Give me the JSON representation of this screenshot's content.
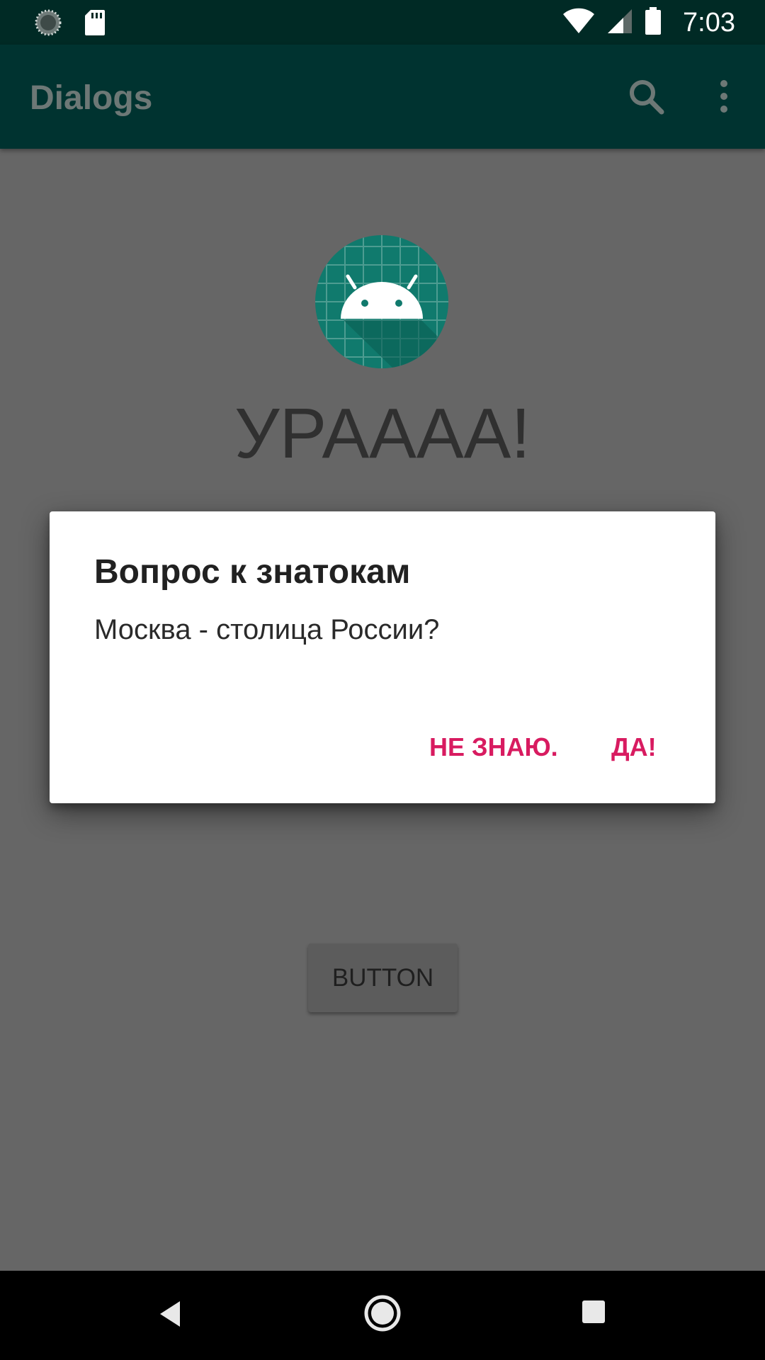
{
  "status_bar": {
    "time": "7:03",
    "left_icons": [
      "sync-icon",
      "sd-card-icon"
    ],
    "right_icons": [
      "wifi-icon",
      "cell-signal-icon",
      "battery-icon"
    ]
  },
  "app_bar": {
    "title": "Dialogs",
    "actions": [
      "search-icon",
      "more-vert-icon"
    ]
  },
  "main": {
    "heading": "УРАААА!",
    "button_label": "BUTTON"
  },
  "dialog": {
    "title": "Вопрос к знатокам",
    "message": "Москва - столица России?",
    "negative_button": "НЕ ЗНАЮ.",
    "positive_button": "ДА!"
  },
  "nav_bar": {
    "buttons": [
      "back-icon",
      "home-icon",
      "recents-icon"
    ]
  },
  "colors": {
    "status_bar": "#002a25",
    "app_bar": "#003330",
    "scrim_background": "#666666",
    "dialog_accent": "#d81b60",
    "logo_teal": "#008577"
  }
}
